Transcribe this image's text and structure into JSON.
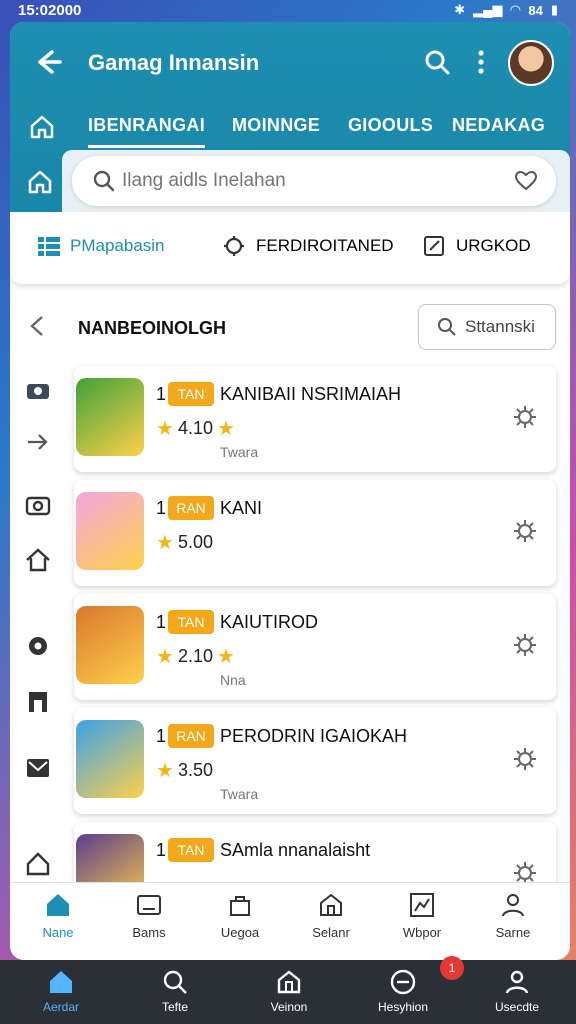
{
  "status_bar": {
    "time": "15:02000",
    "battery": "84"
  },
  "header": {
    "title": "Gamag Innansin"
  },
  "tabs": [
    {
      "label": "IBENRANGAI",
      "active": true
    },
    {
      "label": "MOINNGE",
      "active": false
    },
    {
      "label": "GIOOULS",
      "active": false
    },
    {
      "label": "NEDAKAG",
      "active": false
    }
  ],
  "search": {
    "placeholder": "Ilang aidls Inelahan"
  },
  "segments": [
    {
      "label": "PMapabasin",
      "icon": "grid-icon",
      "active": true
    },
    {
      "label": "FERDIROITANED",
      "icon": "gear-badge-icon",
      "active": false
    },
    {
      "label": "URGKOD",
      "icon": "edit-icon",
      "active": false
    }
  ],
  "content": {
    "title": "NANBEOINOLGH",
    "sort_label": "Sttannski"
  },
  "games": [
    {
      "rank": "1",
      "badge": "TAN",
      "name": "KANIBAII NSRIMAIAH",
      "rating": "4.10",
      "sub": "Twara",
      "thumb_color": "#3fa23a"
    },
    {
      "rank": "1",
      "badge": "RAN",
      "name": "KANI",
      "rating": "5.00",
      "sub": "",
      "thumb_color": "#f2a7e0"
    },
    {
      "rank": "1",
      "badge": "TAN",
      "name": "KAIUTIROD",
      "rating": "2.10",
      "sub": "Nna",
      "thumb_color": "#d9782e"
    },
    {
      "rank": "1",
      "badge": "RAN",
      "name": "PERODRIN IGAIOKAH",
      "rating": "3.50",
      "sub": "Twara",
      "thumb_color": "#3aa2e8"
    },
    {
      "rank": "1",
      "badge": "TAN",
      "name": "SAmla nnanalaisht",
      "rating": "",
      "sub": "",
      "thumb_color": "#5b3d8a"
    }
  ],
  "bottom_nav": [
    {
      "label": "Nane",
      "icon": "home-icon",
      "active": true
    },
    {
      "label": "Bams",
      "icon": "image-icon",
      "active": false
    },
    {
      "label": "Uegoa",
      "icon": "bag-icon",
      "active": false
    },
    {
      "label": "Selanr",
      "icon": "store-icon",
      "active": false
    },
    {
      "label": "Wbpor",
      "icon": "chart-icon",
      "active": false
    },
    {
      "label": "Sarne",
      "icon": "person-icon",
      "active": false
    }
  ],
  "system_nav": [
    {
      "label": "Aerdar",
      "icon": "home-icon",
      "active": true
    },
    {
      "label": "Tefte",
      "icon": "search-icon",
      "active": false
    },
    {
      "label": "Veinon",
      "icon": "building-icon",
      "active": false
    },
    {
      "label": "Hesyhion",
      "icon": "compass-icon",
      "active": false,
      "badge": "1"
    },
    {
      "label": "Usecdte",
      "icon": "person-icon",
      "active": false
    }
  ]
}
